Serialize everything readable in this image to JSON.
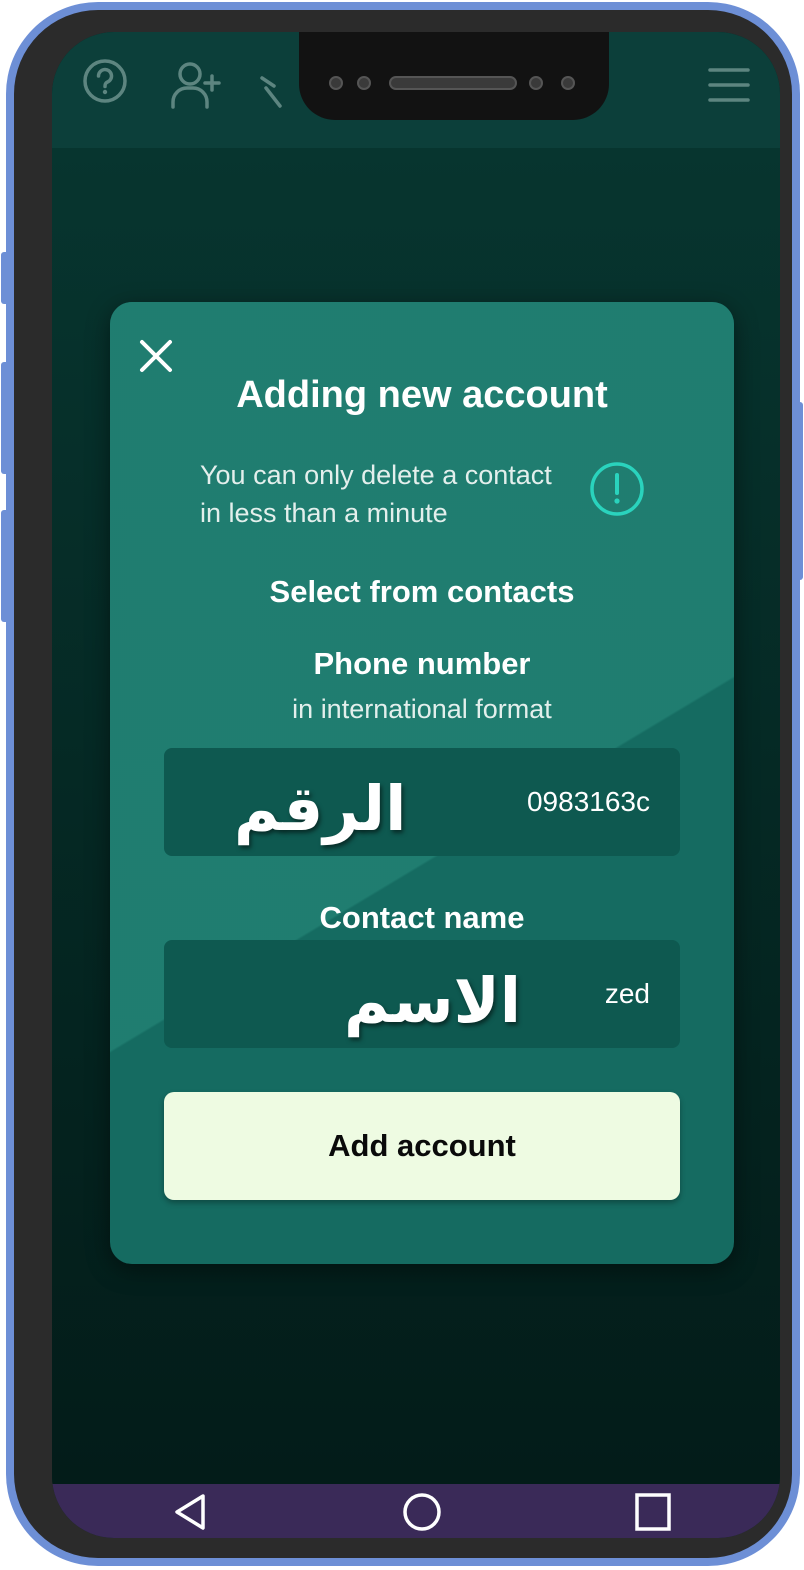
{
  "dialog": {
    "title": "Adding new account",
    "info_text": "You can only delete a contact in less than a minute",
    "select_contacts": "Select from contacts",
    "phone_label": "Phone number",
    "phone_sublabel": "in international format",
    "phone_value": "0983163c",
    "phone_overlay": "الرقم",
    "name_label": "Contact name",
    "name_value": "zed",
    "name_overlay": "الاسم",
    "add_button": "Add account"
  },
  "icons": {
    "topbar": [
      "help-icon",
      "add-user-icon",
      "back-arrow-icon",
      "menu-icon"
    ],
    "dialog": [
      "close-icon",
      "info-icon"
    ],
    "navbar": [
      "nav-back-icon",
      "nav-home-icon",
      "nav-recents-icon"
    ]
  },
  "colors": {
    "frame": "#6d8fd6",
    "topbar": "#0c3f3a",
    "dialog": "#156b61",
    "field": "#0e5950",
    "button": "#eefbe2",
    "info_accent": "#2ad3bd",
    "navbar": "#3a2a58"
  }
}
